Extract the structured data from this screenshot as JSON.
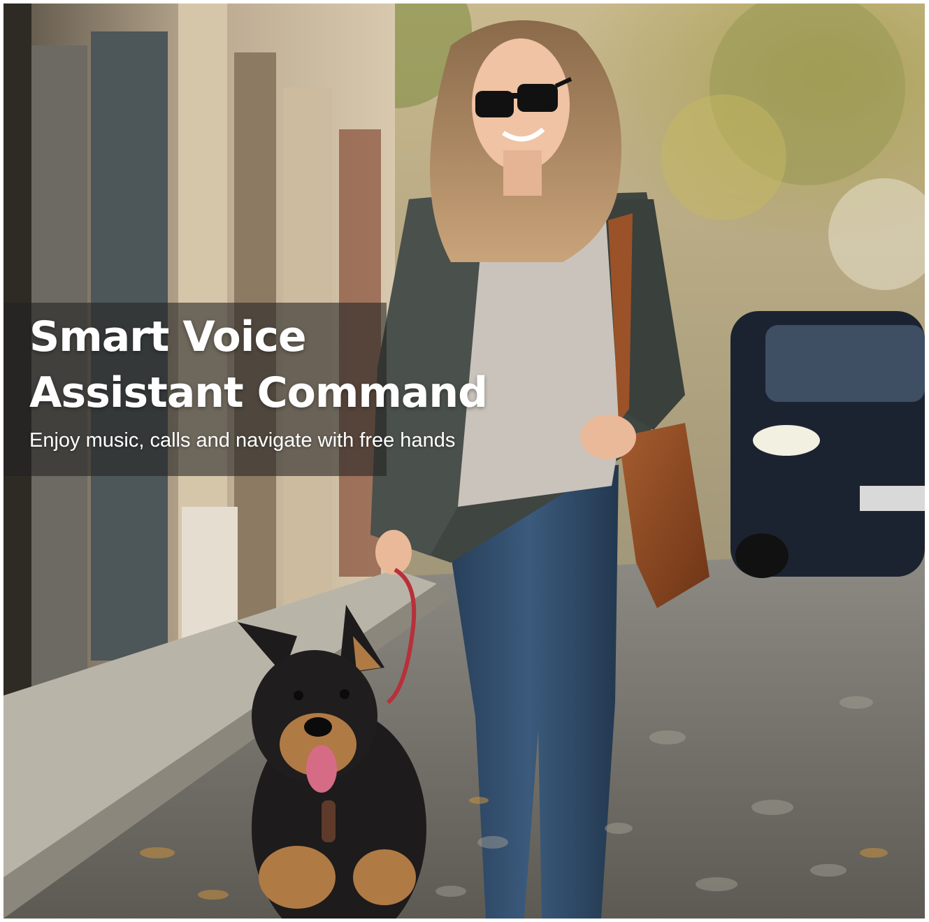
{
  "overlay": {
    "headline_line1": "Smart Voice",
    "headline_line2": "Assistant Command",
    "subheadline": "Enjoy music, calls and navigate with free hands"
  },
  "colors": {
    "overlay_text": "#ffffff",
    "banner": "#222222",
    "jacket": "#3f4540",
    "sweater": "#c9c3bb",
    "jeans": "#2f4a66",
    "bag": "#8a4a24",
    "car": "#1c2330"
  }
}
